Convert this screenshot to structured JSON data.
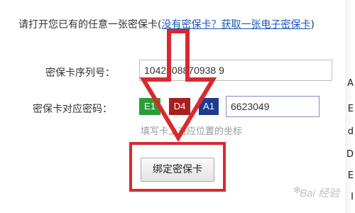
{
  "header": {
    "text": "请打开您已有的任意一张密保卡(",
    "link_text": "没有密保卡？获取一张电子密保卡",
    "end_text": ")"
  },
  "serial": {
    "label": "密保卡序列号：",
    "value": "1042308870938 9"
  },
  "password": {
    "label": "密保卡对应密码：",
    "coords": [
      {
        "text": "E1",
        "color": "#2a9d3a"
      },
      {
        "text": "D4",
        "color": "#a81f1f"
      },
      {
        "text": "A1",
        "color": "#1d3b8f"
      }
    ],
    "value": "6623049"
  },
  "hint": "填写卡上对应位置的坐标",
  "bind_button": "绑定密保卡",
  "edge_chars": [
    "A",
    "E",
    "d",
    "D",
    "E",
    "I"
  ],
  "watermark": "Bai 经验",
  "annotation_color": "#d9292f"
}
